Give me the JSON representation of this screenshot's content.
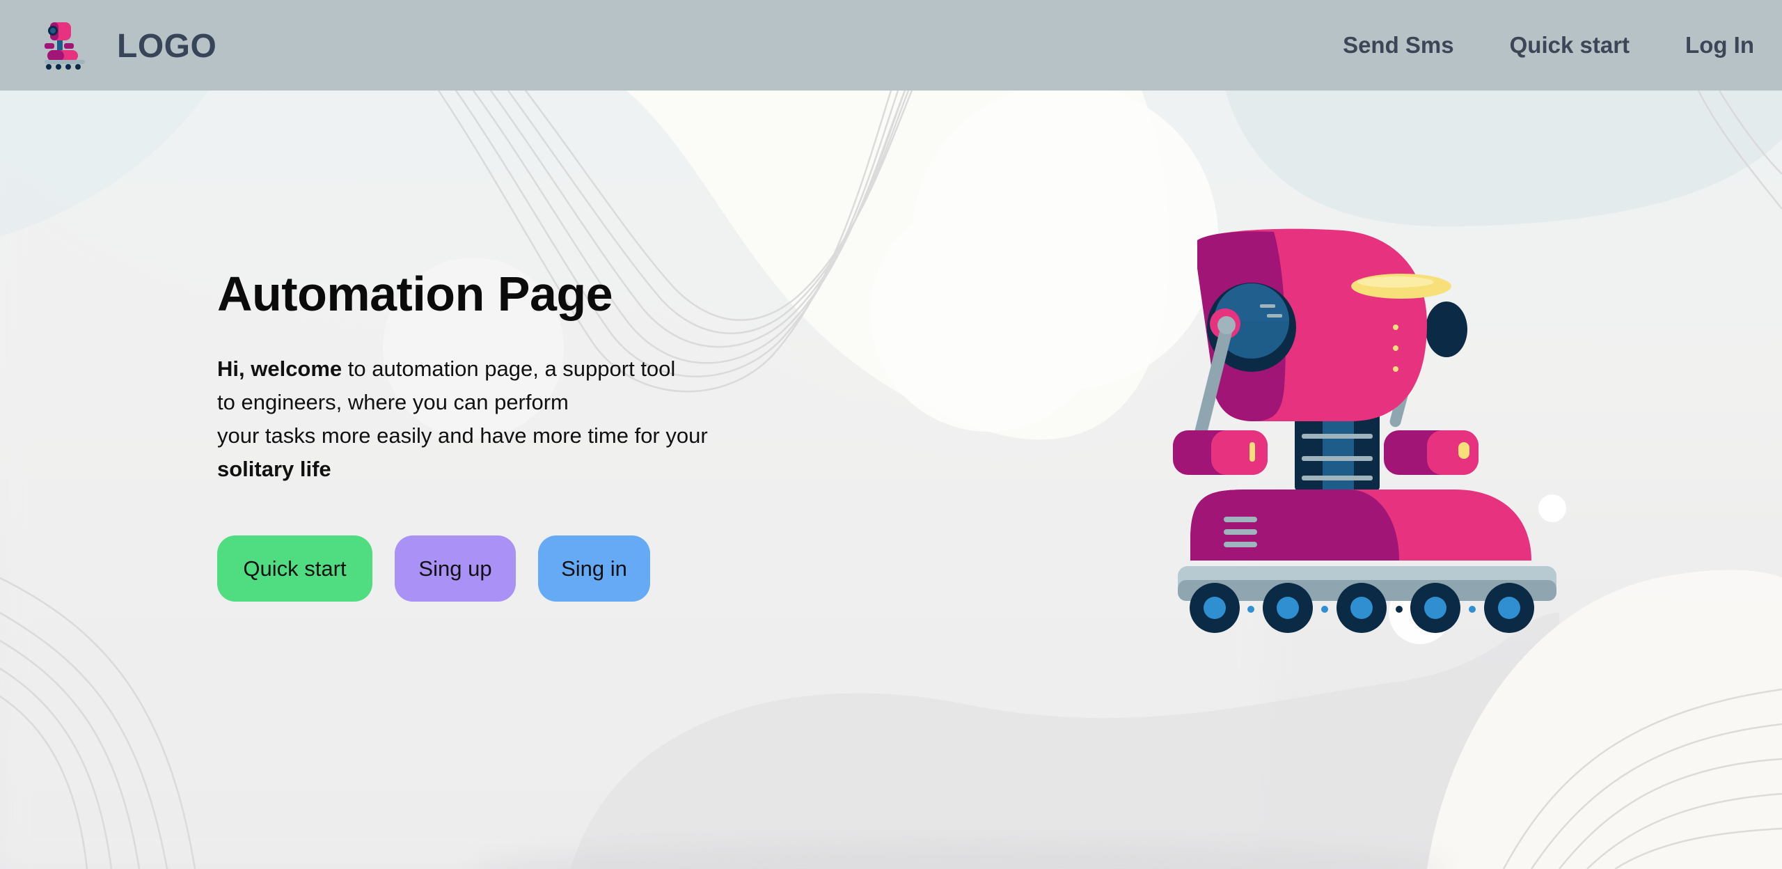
{
  "colors": {
    "navbar_bg": "#b2bdc2",
    "nav_text": "#3c4656",
    "quick_start_button": "#50dd82",
    "sign_up_button": "#a991f6",
    "sign_in_button": "#66aaf6",
    "robot_primary": "#e6327f",
    "robot_dark": "#0b2a45"
  },
  "header": {
    "logo_icon": "robot-logo-icon",
    "logo_text": "LOGO",
    "nav": {
      "send_sms": "Send Sms",
      "quick_start": "Quick start",
      "log_in": "Log In"
    }
  },
  "hero": {
    "title": "Automation Page",
    "intro_bold": "Hi, welcome",
    "line1_rest": " to automation page, a support tool",
    "line2": "to engineers, where you can perform",
    "line3": "your tasks more easily and have more time for your",
    "line4_bold": "solitary life",
    "buttons": {
      "quick_start": "Quick start",
      "sign_up": "Sing up",
      "sign_in": "Sing in"
    },
    "illustration": "robot-illustration"
  }
}
